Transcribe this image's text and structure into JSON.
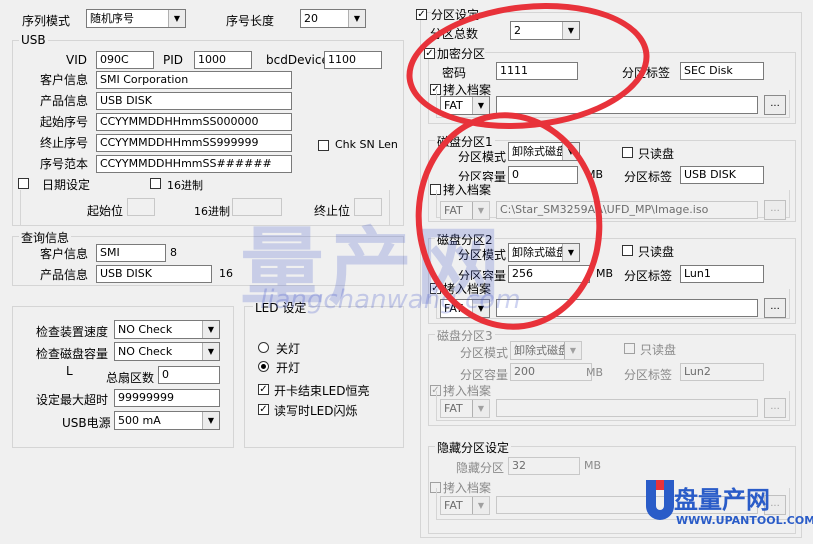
{
  "top": {
    "serial_mode_label": "序列模式",
    "serial_mode_value": "随机序号",
    "serial_len_label": "序号长度",
    "serial_len_value": "20"
  },
  "usb": {
    "title": "USB",
    "vid_label": "VID",
    "vid_value": "090C",
    "pid_label": "PID",
    "pid_value": "1000",
    "bcd_label": "bcdDevice",
    "bcd_value": "1100",
    "customer_label": "客户信息",
    "customer_value": "SMI Corporation",
    "product_label": "产品信息",
    "product_value": "USB DISK",
    "start_serial_label": "起始序号",
    "start_serial_value": "CCYYMMDDHHmmSS000000",
    "end_serial_label": "终止序号",
    "end_serial_value": "CCYYMMDDHHmmSS999999",
    "serial_sample_label": "序号范本",
    "serial_sample_value": "CCYYMMDDHHmmSS######",
    "chk_sn_len_label": "Chk SN Len",
    "date_set_label": "日期设定",
    "hex16_label": "16进制",
    "start_pos_label": "起始位",
    "hex16b_label": "16进制",
    "end_pos_label": "终止位"
  },
  "query": {
    "title": "查询信息",
    "customer_label": "客户信息",
    "customer_value": "SMI",
    "customer_len": "8",
    "product_label": "产品信息",
    "product_value": "USB DISK",
    "product_len": "16"
  },
  "check": {
    "speed_label": "检查装置速度",
    "speed_value": "NO Check",
    "capacity_label": "检查磁盘容量",
    "capacity_value": "NO Check",
    "l_label": "L",
    "sectors_label": "总扇区数",
    "sectors_value": "0",
    "timeout_label": "设定最大超时",
    "timeout_value": "99999999",
    "power_label": "USB电源",
    "power_value": "500 mA"
  },
  "led": {
    "title": "LED 设定",
    "off_label": "关灯",
    "on_label": "开灯",
    "end_bright_label": "开卡结束LED恒亮",
    "rw_blink_label": "读写时LED闪烁"
  },
  "partition": {
    "title": "分区设定",
    "total_label": "分区总数",
    "total_value": "2",
    "enc": {
      "title": "加密分区",
      "password_label": "密码",
      "password_value": "1111",
      "tag_label": "分区标签",
      "tag_value": "SEC Disk",
      "image_label": "拷入档案",
      "fs_value": "FAT",
      "browse": "..."
    },
    "disk1": {
      "title": "磁盘分区1",
      "mode_label": "分区模式",
      "mode_value": "卸除式磁盘",
      "readonly_label": "只读盘",
      "capacity_label": "分区容量",
      "capacity_value": "0",
      "unit": "MB",
      "tag_label": "分区标签",
      "tag_value": "USB DISK",
      "image_label": "拷入档案",
      "fs_value": "FAT",
      "image_path": "C:\\Star_SM3259AA\\UFD_MP\\Image.iso",
      "browse": "..."
    },
    "disk2": {
      "title": "磁盘分区2",
      "mode_label": "分区模式",
      "mode_value": "卸除式磁盘",
      "readonly_label": "只读盘",
      "capacity_label": "分区容量",
      "capacity_value": "256",
      "unit": "MB",
      "tag_label": "分区标签",
      "tag_value": "Lun1",
      "image_label": "拷入档案",
      "fs_value": "FAT",
      "browse": "..."
    },
    "disk3": {
      "title": "磁盘分区3",
      "mode_label": "分区模式",
      "mode_value": "卸除式磁盘",
      "readonly_label": "只读盘",
      "capacity_label": "分区容量",
      "capacity_value": "200",
      "unit": "MB",
      "tag_label": "分区标签",
      "tag_value": "Lun2",
      "image_label": "拷入档案",
      "fs_value": "FAT",
      "browse": "..."
    },
    "hidden": {
      "title": "隐藏分区设定",
      "label": "隐藏分区",
      "value": "32",
      "unit": "MB",
      "image_label": "拷入档案",
      "fs_value": "FAT",
      "browse": "..."
    }
  },
  "watermark": {
    "text_cn": "量产网",
    "text_en": "liangchanwang.com",
    "logo_cn": "盘量产网",
    "logo_url": "WWW.UPANTOOL.COM"
  },
  "colors": {
    "annotation": "#e8323a",
    "logo_blue": "#2a5cc8",
    "logo_red": "#e8323a"
  }
}
